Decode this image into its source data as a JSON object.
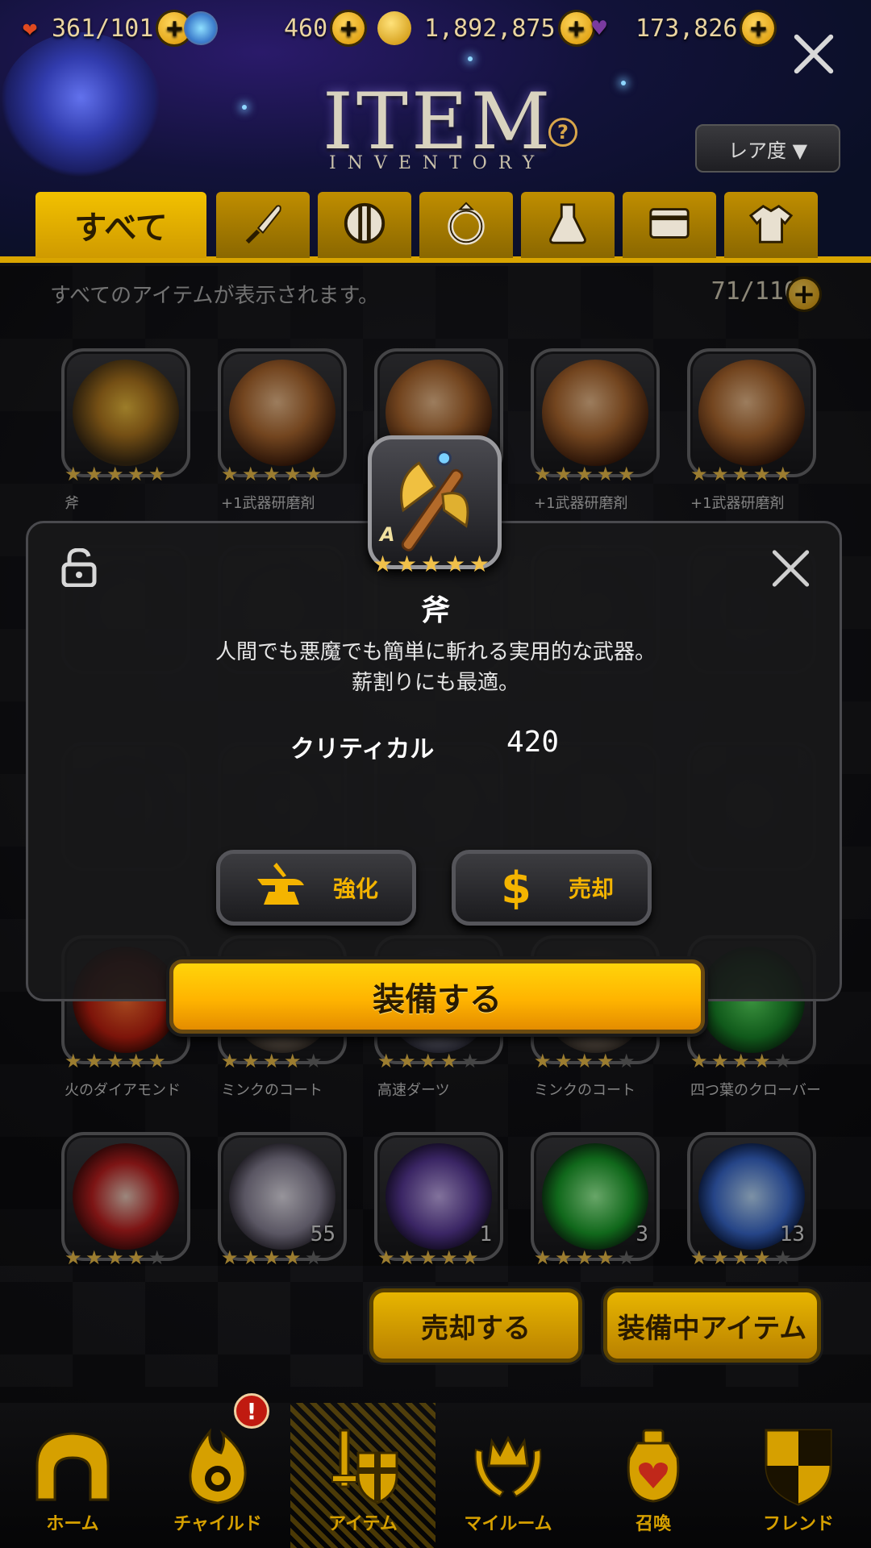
{
  "resources": {
    "stamina": "361/101",
    "gems": "460",
    "coins": "1,892,875",
    "crystals": "173,826"
  },
  "header": {
    "title": "ITEM",
    "subtitle": "INVENTORY",
    "help": "?",
    "sort_label": "レア度 ▼"
  },
  "tabs": [
    {
      "label": "すべて",
      "icon": "all",
      "active": true
    },
    {
      "icon": "knife-icon"
    },
    {
      "icon": "shield-icon"
    },
    {
      "icon": "ring-icon"
    },
    {
      "icon": "flask-icon"
    },
    {
      "icon": "card-icon"
    },
    {
      "icon": "shirt-icon"
    }
  ],
  "info": {
    "text": "すべてのアイテムが表示されます。",
    "capacity": "71/110"
  },
  "grid": {
    "row1": [
      {
        "name": "斧",
        "stars": 5
      },
      {
        "name": "+1武器研磨剤",
        "stars": 5
      },
      {
        "name": "",
        "stars": 5
      },
      {
        "name": "+1武器研磨剤",
        "stars": 5
      },
      {
        "name": "+1武器研磨剤",
        "stars": 5
      }
    ],
    "row4": [
      {
        "name": "火のダイアモンド",
        "stars": 5
      },
      {
        "name": "ミンクのコート",
        "stars": 4
      },
      {
        "name": "高速ダーツ",
        "stars": 4
      },
      {
        "name": "ミンクのコート",
        "stars": 4
      },
      {
        "name": "四つ葉のクローバー",
        "stars": 4
      }
    ],
    "row5": [
      {
        "count": "",
        "stars": 4
      },
      {
        "count": "55",
        "stars": 4
      },
      {
        "count": "1",
        "stars": 5
      },
      {
        "count": "3",
        "stars": 4
      },
      {
        "count": "13",
        "stars": 4
      }
    ]
  },
  "modal": {
    "item_name": "斧",
    "rank": "A",
    "stars": 5,
    "description_line1": "人間でも悪魔でも簡単に斬れる実用的な武器。",
    "description_line2": "薪割りにも最適。",
    "stat_label": "クリティカル",
    "stat_value": "420",
    "enhance_label": "強化",
    "sell_label": "売却",
    "equip_label": "装備する"
  },
  "actions": {
    "sell": "売却する",
    "equipped": "装備中アイテム"
  },
  "nav": [
    {
      "label": "ホーム",
      "icon": "home-icon"
    },
    {
      "label": "チャイルド",
      "icon": "flame-icon"
    },
    {
      "label": "アイテム",
      "icon": "sword-shield-icon",
      "active": true
    },
    {
      "label": "マイルーム",
      "icon": "laurel-crown-icon"
    },
    {
      "label": "召喚",
      "icon": "potion-heart-icon"
    },
    {
      "label": "フレンド",
      "icon": "friend-shield-icon"
    }
  ],
  "nav_badge": "!",
  "colors": {
    "accent_gold": "#f4b400",
    "tab_gold": "#d9a500",
    "equip_orange": "#ffb400"
  }
}
